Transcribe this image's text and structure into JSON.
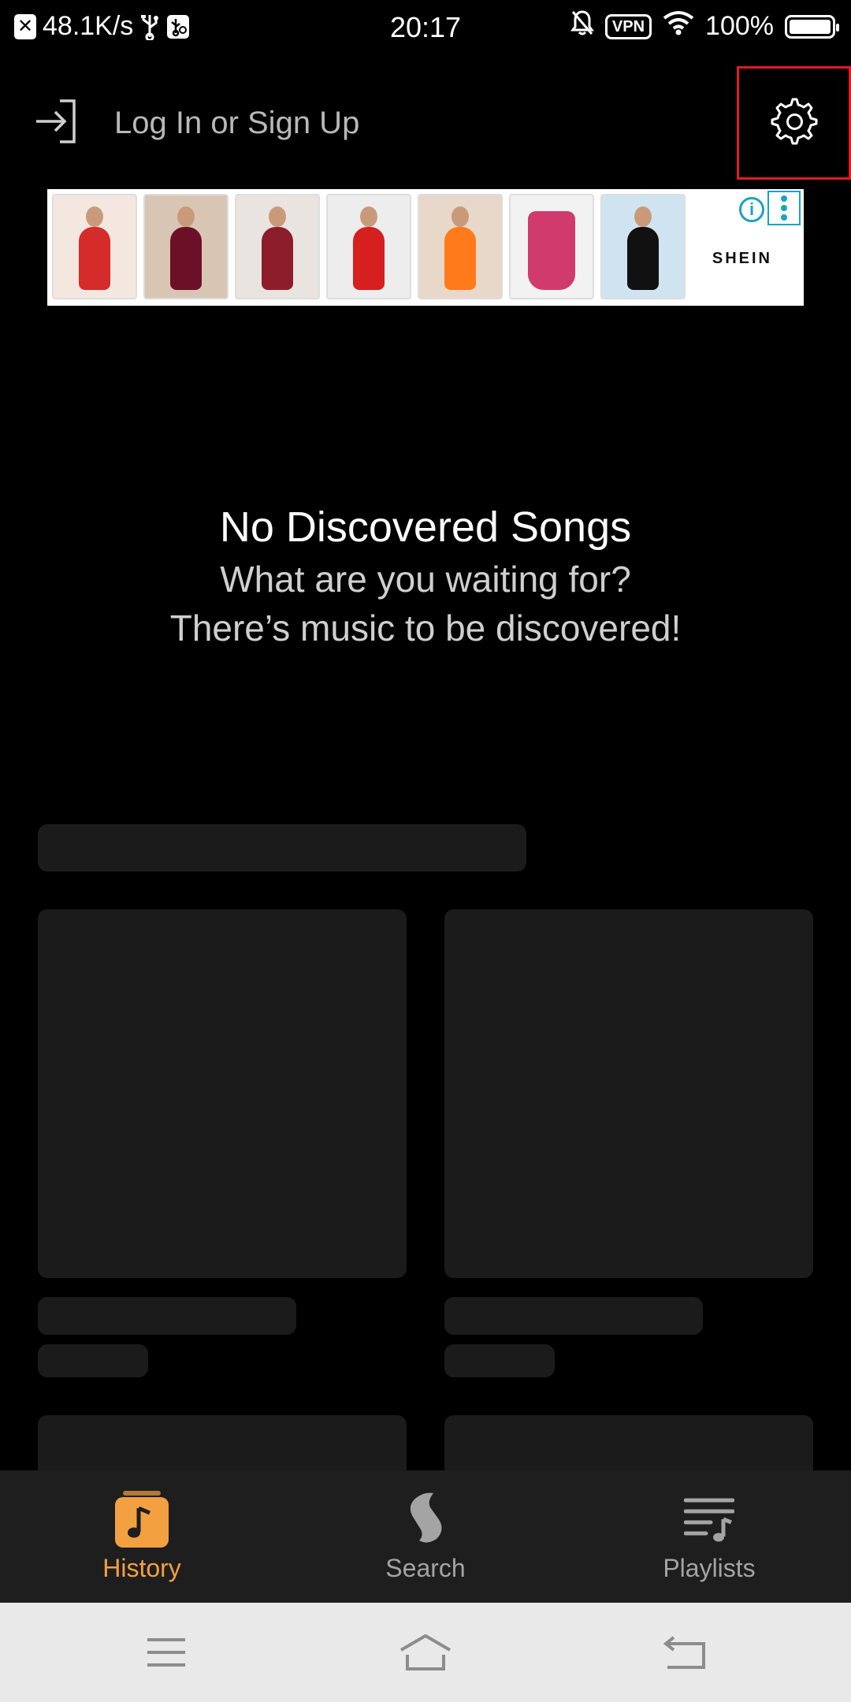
{
  "status_bar": {
    "speed": "48.1K/s",
    "time": "20:17",
    "vpn": "VPN",
    "battery": "100%",
    "battery_level": 1.0,
    "icons": [
      "notification-x-icon",
      "usb-icon",
      "usb-debug-icon",
      "bell-off-icon",
      "vpn-icon",
      "wifi-icon",
      "battery-icon"
    ]
  },
  "header": {
    "login_label": "Log In or Sign Up",
    "login_icon": "login-arrow-icon",
    "settings_icon": "gear-icon"
  },
  "ad": {
    "brand": "SHEIN",
    "info_icon": "info-icon",
    "menu_icon": "ad-options-icon",
    "products": [
      {
        "bg": "#f4e7e0",
        "garment": "#d52b2b"
      },
      {
        "bg": "#d9c5b4",
        "garment": "#6b1026"
      },
      {
        "bg": "#e9e4df",
        "garment": "#8d1d2b"
      },
      {
        "bg": "#ededed",
        "garment": "#d61f1f"
      },
      {
        "bg": "#e8d8c9",
        "garment": "#ff7a1a"
      },
      {
        "bg": "#f2f2f2",
        "garment": "#d13a6d"
      },
      {
        "bg": "#cfe4f0",
        "garment": "#111111"
      }
    ]
  },
  "empty_state": {
    "title": "No Discovered Songs",
    "subtitle_line1": "What are you waiting for?",
    "subtitle_line2": "There’s music to be discovered!"
  },
  "bottom_nav": {
    "items": [
      {
        "label": "History",
        "icon": "music-note-icon",
        "active": true
      },
      {
        "label": "Search",
        "icon": "shazam-icon",
        "active": false
      },
      {
        "label": "Playlists",
        "icon": "playlist-icon",
        "active": false
      }
    ],
    "active_color": "#f3a041",
    "inactive_color": "#a4a4a4"
  },
  "system_nav": {
    "icons": [
      "menu-icon",
      "home-icon",
      "back-icon"
    ]
  }
}
